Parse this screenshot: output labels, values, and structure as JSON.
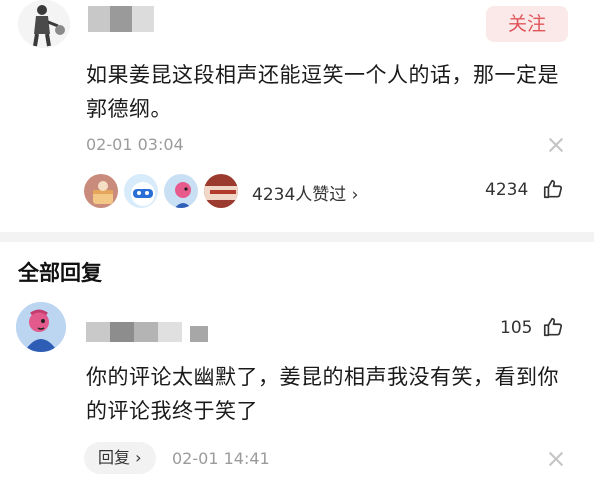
{
  "comment": {
    "follow_label": "关注",
    "text": "如果姜昆这段相声还能逗笑一个人的话，那一定是郭德纲。",
    "time": "02-01 03:04",
    "liked_summary": "4234人赞过 ›",
    "like_count": "4234"
  },
  "replies_section": {
    "title": "全部回复"
  },
  "reply": {
    "like_count": "105",
    "text": "你的评论太幽默了，姜昆的相声我没有笑，看到你的评论我终于笑了",
    "reply_label": "回复 ›",
    "time": "02-01 14:41"
  },
  "colors": {
    "follow_text": "#e0565a",
    "follow_bg": "#fbe9e9",
    "muted": "#9b9b9b",
    "divider": "#f3f3f3"
  },
  "icons": [
    "close-icon",
    "thumbs-up-icon",
    "chevron-right-icon"
  ]
}
